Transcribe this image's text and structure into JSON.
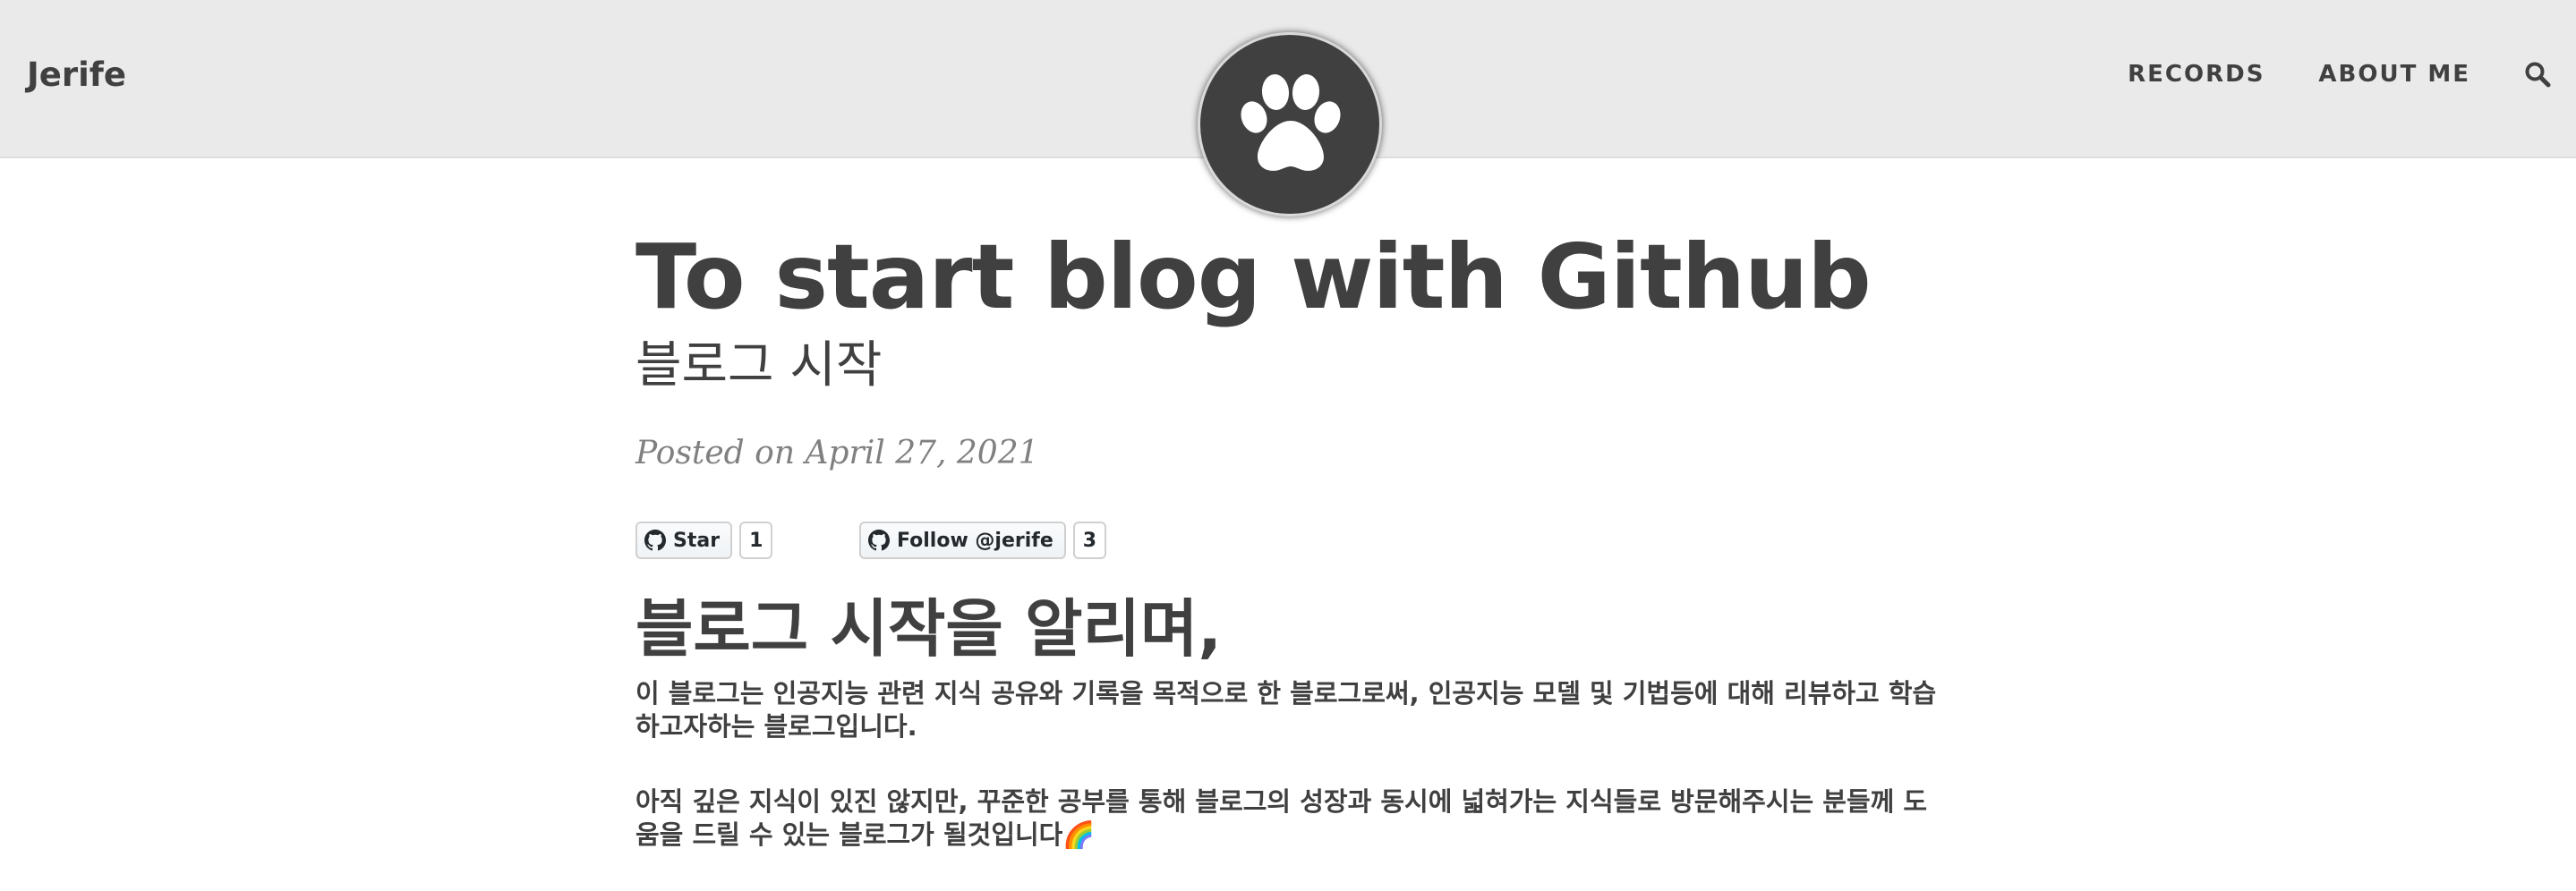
{
  "navbar": {
    "brand": "Jerife",
    "links": [
      "RECORDS",
      "ABOUT ME"
    ],
    "search_icon": "search-icon",
    "avatar_icon": "paw-icon",
    "background": "#eaeaea"
  },
  "post": {
    "title": "To start blog with Github",
    "subtitle": "블로그 시작",
    "meta": "Posted on April 27, 2021",
    "github_buttons": {
      "star_label": "Star",
      "star_count": "1",
      "follow_label": "Follow @jerife",
      "follow_count": "3",
      "icon": "github-icon"
    },
    "heading": "블로그 시작을 알리며,",
    "paragraphs": [
      "이 블로그는 인공지능 관련 지식 공유와 기록을 목적으로 한 블로그로써, 인공지능 모델 및 기법등에 대해 리뷰하고 학습하고자하는 블로그입니다.",
      "아직 깊은 지식이 있진 않지만, 꾸준한 공부를 통해 블로그의 성장과 동시에 넓혀가는 지식들로 방문해주시는 분들께 도움을 드릴 수 있는 블로그가 될것입니다🌈"
    ]
  },
  "colors": {
    "text": "#404040",
    "meta": "#808080",
    "avatar_bg": "#404040"
  }
}
